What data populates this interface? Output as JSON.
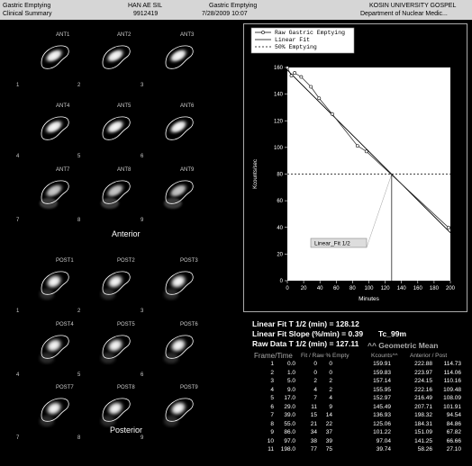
{
  "header": {
    "left_top": "Gastric Emptying",
    "left_bottom": "Clinical Summary",
    "patient_name": "HAN AE SIL",
    "patient_id": "9912419",
    "study_title": "Gastric Emptying",
    "study_date": "7/28/2009 10:07",
    "institution": "KOSIN UNIVERSITY GOSPEL",
    "department": "Department of  Nuclear Medic..."
  },
  "anterior": {
    "section_label": "Anterior",
    "frames": [
      {
        "label": "ANT1",
        "number": "1"
      },
      {
        "label": "ANT2",
        "number": "2"
      },
      {
        "label": "ANT3",
        "number": "3"
      },
      {
        "label": "ANT4",
        "number": "4"
      },
      {
        "label": "ANT5",
        "number": "5"
      },
      {
        "label": "ANT6",
        "number": "6"
      },
      {
        "label": "ANT7",
        "number": "7"
      },
      {
        "label": "ANT8",
        "number": "8"
      },
      {
        "label": "ANT9",
        "number": "9"
      }
    ]
  },
  "posterior": {
    "section_label": "Posterior",
    "frames": [
      {
        "label": "POST1",
        "number": "1"
      },
      {
        "label": "POST2",
        "number": "2"
      },
      {
        "label": "POST3",
        "number": "3"
      },
      {
        "label": "POST4",
        "number": "4"
      },
      {
        "label": "POST5",
        "number": "5"
      },
      {
        "label": "POST6",
        "number": "6"
      },
      {
        "label": "POST7",
        "number": "7"
      },
      {
        "label": "POST8",
        "number": "8"
      },
      {
        "label": "POST9",
        "number": "9"
      }
    ]
  },
  "chart_data": {
    "type": "line",
    "xlabel": "Minutes",
    "ylabel": "Kcounts/sec",
    "xlim": [
      0,
      200
    ],
    "ylim": [
      0,
      160
    ],
    "x_ticks": [
      "0",
      "20",
      "40",
      "60",
      "80",
      "100",
      "120",
      "140",
      "160",
      "180",
      "200"
    ],
    "y_ticks": [
      "0",
      "20",
      "40",
      "60",
      "80",
      "100",
      "120",
      "140",
      "160"
    ],
    "legend": [
      "Raw Gastric Emptying",
      "Linear Fit",
      "50% Emptying"
    ],
    "annotation": "Linear_Fit 1/2",
    "series": [
      {
        "name": "Raw Gastric Emptying",
        "x": [
          0,
          5,
          9,
          17,
          29,
          39,
          55,
          86,
          97,
          198
        ],
        "y": [
          159.9,
          153.8,
          155.9,
          152.9,
          145.5,
          136.9,
          125.1,
          101.2,
          97.0,
          39.7
        ]
      },
      {
        "name": "Linear Fit",
        "x": [
          0,
          200
        ],
        "y": [
          158,
          36
        ]
      },
      {
        "name": "50% Emptying",
        "x": [
          0,
          200
        ],
        "y": [
          80,
          80
        ]
      }
    ],
    "half_time_marker_x": 128
  },
  "stats": {
    "linear_fit_t_half": "Linear Fit T 1/2 (min) = 128.12",
    "linear_fit_slope": "Linear Fit Slope (%/min) = 0.39",
    "raw_data_t_half": "Raw Data T 1/2 (min) = 127.11",
    "isotope": "Tc_99m",
    "geometric_mean_title": "^^ Geometric Mean"
  },
  "table": {
    "headers": {
      "frame_time": "Frame/Time",
      "fit_raw": "Fit / Raw % Empty",
      "kcounts": "Kcounts^^",
      "ant_post": "Anterior / Post"
    },
    "rows": [
      {
        "frame": "1",
        "time": "0.0",
        "fit": "0",
        "raw": "0",
        "kcounts": "159.91",
        "ant": "222.88",
        "post": "114.73"
      },
      {
        "frame": "2",
        "time": "1.0",
        "fit": "0",
        "raw": "0",
        "kcounts": "159.83",
        "ant": "223.97",
        "post": "114.06"
      },
      {
        "frame": "3",
        "time": "5.0",
        "fit": "2",
        "raw": "2",
        "kcounts": "157.14",
        "ant": "224.15",
        "post": "110.16"
      },
      {
        "frame": "4",
        "time": "9.0",
        "fit": "4",
        "raw": "2",
        "kcounts": "155.95",
        "ant": "222.16",
        "post": "109.48"
      },
      {
        "frame": "5",
        "time": "17.0",
        "fit": "7",
        "raw": "4",
        "kcounts": "152.97",
        "ant": "216.49",
        "post": "108.09"
      },
      {
        "frame": "6",
        "time": "29.0",
        "fit": "11",
        "raw": "9",
        "kcounts": "145.49",
        "ant": "207.71",
        "post": "101.91"
      },
      {
        "frame": "7",
        "time": "39.0",
        "fit": "15",
        "raw": "14",
        "kcounts": "136.93",
        "ant": "198.32",
        "post": "94.54"
      },
      {
        "frame": "8",
        "time": "55.0",
        "fit": "21",
        "raw": "22",
        "kcounts": "125.06",
        "ant": "184.31",
        "post": "84.86"
      },
      {
        "frame": "9",
        "time": "86.0",
        "fit": "34",
        "raw": "37",
        "kcounts": "101.22",
        "ant": "151.09",
        "post": "67.82"
      },
      {
        "frame": "10",
        "time": "97.0",
        "fit": "38",
        "raw": "39",
        "kcounts": "97.04",
        "ant": "141.25",
        "post": "66.66"
      },
      {
        "frame": "11",
        "time": "198.0",
        "fit": "77",
        "raw": "75",
        "kcounts": "39.74",
        "ant": "58.26",
        "post": "27.10"
      }
    ]
  }
}
